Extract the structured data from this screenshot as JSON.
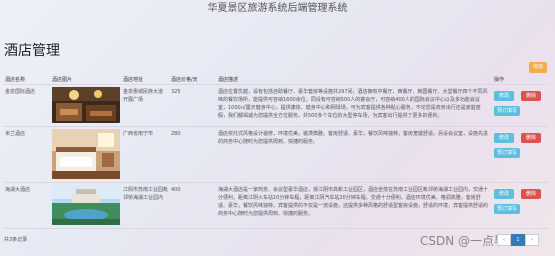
{
  "app": {
    "title": "华夏景区旅游系统后端管理系统"
  },
  "page": {
    "title": "酒店管理",
    "add_label": "增加"
  },
  "table": {
    "headers": [
      "酒店名称",
      "酒店图片",
      "酒店地址",
      "酒店价格/天",
      "酒店描述",
      "操作"
    ],
    "rows": [
      {
        "name": "金泉国际酒店",
        "address": "金泉惠城民族大道开展广场",
        "price": "325",
        "description": "酒店位置优越，设有包括自助餐厅、豪华套房等设施共297间，酒店拥有中餐厅、西餐厅、韩国餐厅、大堂餐厅四个不同风味的餐饮场所，能提供可容纳1600余位，同设有可容纳500人的宴会厅，可容纳400人的国际会议中心以及多功能会议室，1000㎡露天健身中心，提供康体、健身中心和网球场，可为宾客提供各种贴心服务，不论您是商务出行还是家庭度假，我们都竭诚为您提供全方位服务。共500多个车位的大型停车场，为宾客出行提供了更多的便利。",
        "buttons": {
          "edit": "修改",
          "delete": "删除",
          "recommend": "预订填写"
        }
      },
      {
        "name": "米兰酒店",
        "address": "广西省南宁市",
        "price": "280",
        "description": "酒店依托式风格设计装修，环境优美，装潢典雅。客房舒适、豪华，餐饮风味独特，客房宽敞舒适，另设会议室，设施先进的商务中心随时为您提供周到、快捷的服务。",
        "buttons": {
          "edit": "修改",
          "delete": "删除",
          "recommend": "预订填写"
        }
      },
      {
        "name": "海湖大酒店",
        "address": "江阴市苏南工业园毗邻桥海湖工业园内",
        "price": "400",
        "description": "海湖大酒店是一家商务、会议型豪华酒店，濒江阴市高新工业园区，酒店坐落在苏南工业园区毗邻桥海湖工业园内，交通十分便利，距离江阴火车站10分钟车程，距离江阴汽车站20分钟车程，交通十分便利。酒店环境优美，格调高雅，客房舒适、豪华，餐饮风味独特，宾客提供的不仅是一流设施，还提供多种风格的舒适型客房设施，舒适的环境，宾客提供舒适的商务中心随时为您提供周到、快捷的服务。",
        "buttons": {
          "edit": "修改",
          "delete": "删除",
          "recommend": "预订填写"
        }
      }
    ]
  },
  "footer": {
    "count": "共3条记录"
  },
  "pagination": {
    "prev": "‹",
    "current": "1",
    "next": "›"
  },
  "watermark": "CSDN @一点毕设",
  "colors": {
    "warning": "#f0ad4e",
    "info": "#5bc0de",
    "danger": "#d9534f",
    "primary": "#337ab7"
  }
}
